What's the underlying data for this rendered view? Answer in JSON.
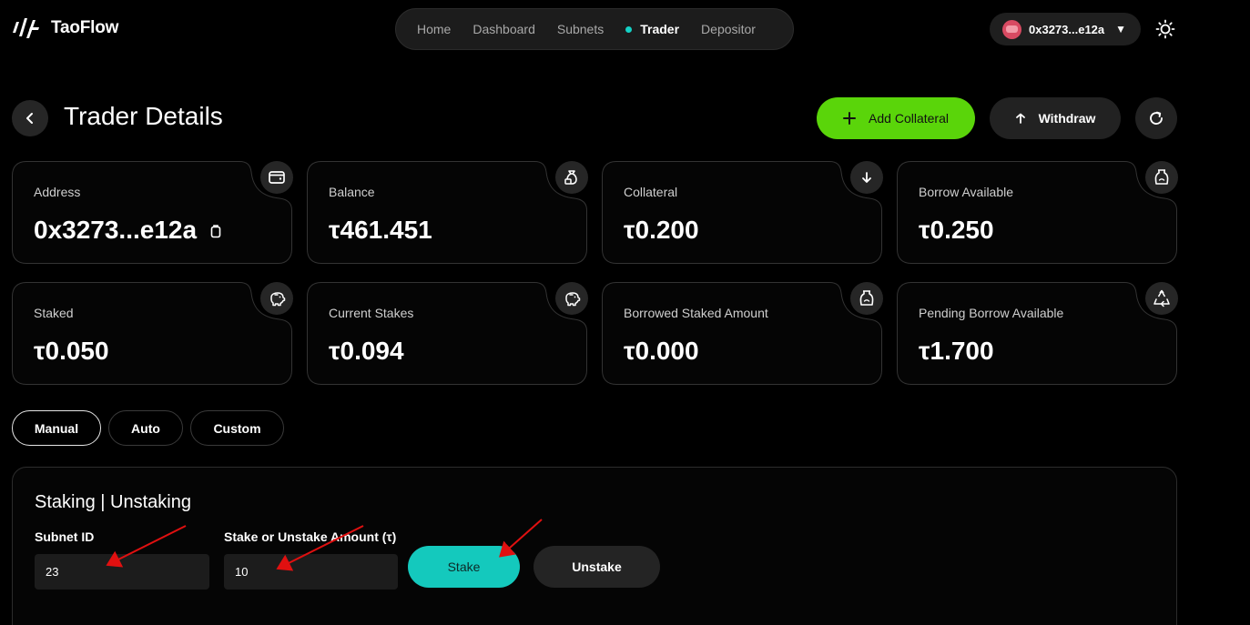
{
  "header": {
    "brand": "TaoFlow",
    "nav": [
      {
        "label": "Home",
        "active": false
      },
      {
        "label": "Dashboard",
        "active": false
      },
      {
        "label": "Subnets",
        "active": false
      },
      {
        "label": "Trader",
        "active": true
      },
      {
        "label": "Depositor",
        "active": false
      }
    ],
    "wallet_address": "0x3273...e12a",
    "wallet_caret": "▼"
  },
  "page": {
    "title": "Trader Details",
    "add_collateral_label": "Add Collateral",
    "withdraw_label": "Withdraw"
  },
  "stats": [
    {
      "label": "Address",
      "value": "0x3273...e12a",
      "icon": "wallet-icon"
    },
    {
      "label": "Balance",
      "value": "τ461.451",
      "icon": "money-bag-icon"
    },
    {
      "label": "Collateral",
      "value": "τ0.200",
      "icon": "arrow-down-icon"
    },
    {
      "label": "Borrow Available",
      "value": "τ0.250",
      "icon": "jar-icon"
    },
    {
      "label": "Staked",
      "value": "τ0.050",
      "icon": "piggy-bank-icon"
    },
    {
      "label": "Current Stakes",
      "value": "τ0.094",
      "icon": "piggy-bank-icon"
    },
    {
      "label": "Borrowed Staked Amount",
      "value": "τ0.000",
      "icon": "jar-icon"
    },
    {
      "label": "Pending Borrow Available",
      "value": "τ1.700",
      "icon": "recycle-icon"
    }
  ],
  "tabs": [
    {
      "label": "Manual",
      "active": true
    },
    {
      "label": "Auto",
      "active": false
    },
    {
      "label": "Custom",
      "active": false
    }
  ],
  "staking": {
    "title": "Staking | Unstaking",
    "subnet_label": "Subnet ID",
    "subnet_value": "23",
    "amount_label": "Stake or Unstake Amount (τ)",
    "amount_value": "10",
    "stake_label": "Stake",
    "unstake_label": "Unstake"
  },
  "colors": {
    "accent_green": "#5ad50a",
    "accent_teal": "#14c9bd",
    "annotation_red": "#e01010"
  }
}
